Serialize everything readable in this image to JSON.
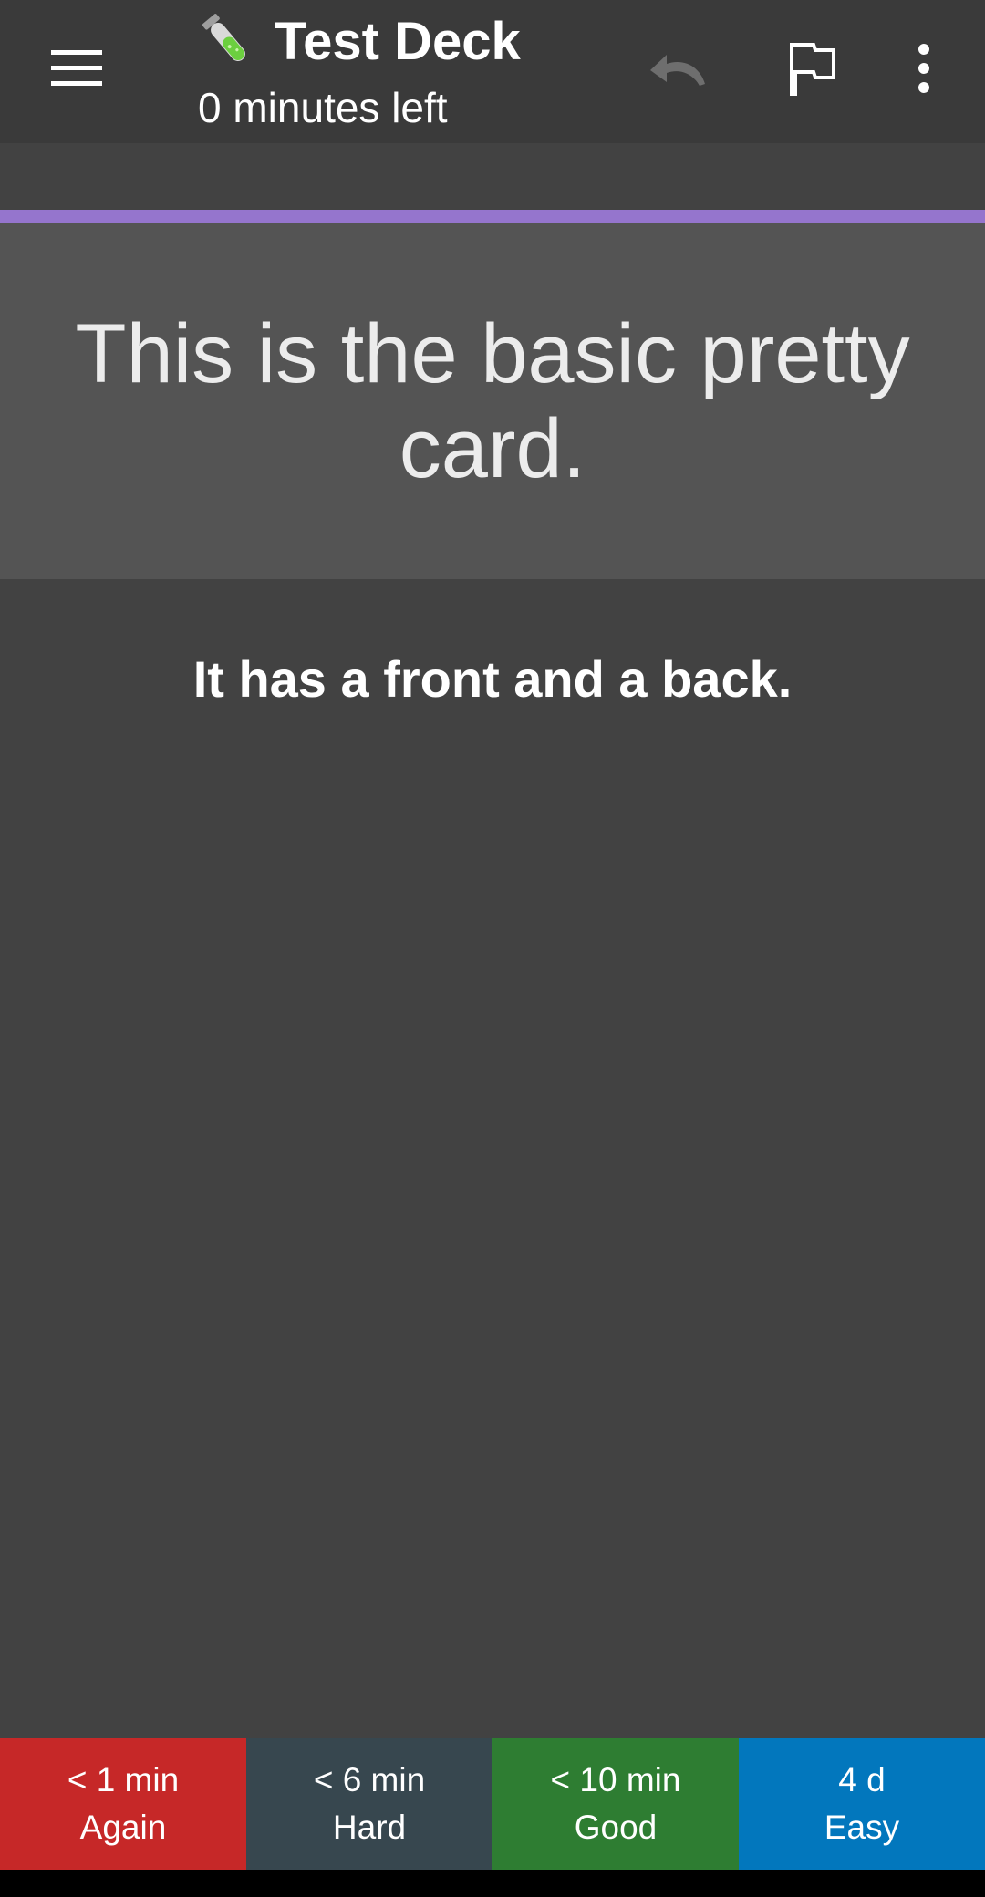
{
  "toolbar": {
    "title": "Test Deck",
    "subtitle": "0 minutes left",
    "title_icon": "test-tube-icon",
    "menu_icon": "hamburger-menu-icon",
    "undo_icon": "undo-icon",
    "flag_icon": "flag-icon",
    "more_icon": "more-vert-icon"
  },
  "card": {
    "front": "This is the basic pretty card.",
    "back": "It has a front and a back."
  },
  "answers": [
    {
      "interval": "< 1 min",
      "label": "Again",
      "color": "#c62828"
    },
    {
      "interval": "< 6 min",
      "label": "Hard",
      "color": "#37474f"
    },
    {
      "interval": "< 10 min",
      "label": "Good",
      "color": "#2e7d32"
    },
    {
      "interval": "4 d",
      "label": "Easy",
      "color": "#0277bd"
    }
  ],
  "colors": {
    "background": "#424242",
    "toolbar": "#3a3a3a",
    "accent": "#9575cd",
    "front_panel": "#545454"
  }
}
